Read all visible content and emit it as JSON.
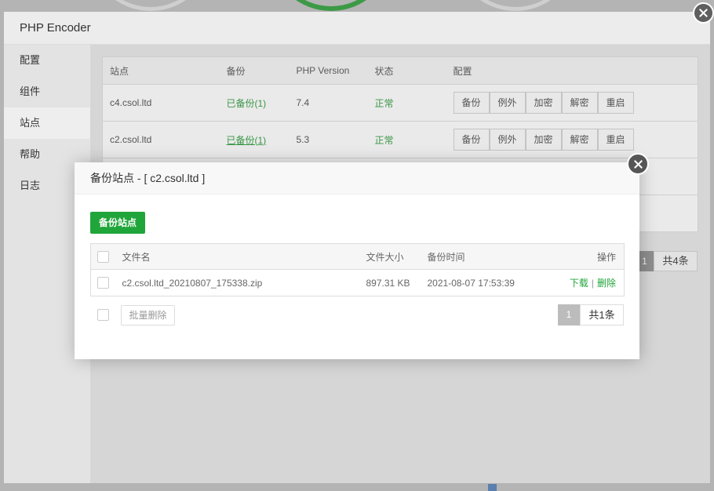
{
  "window": {
    "title": "PHP Encoder",
    "sidebar": {
      "items": [
        {
          "label": "配置",
          "active": false
        },
        {
          "label": "组件",
          "active": false
        },
        {
          "label": "站点",
          "active": true
        },
        {
          "label": "帮助",
          "active": false
        },
        {
          "label": "日志",
          "active": false
        }
      ]
    },
    "sites_table": {
      "headers": {
        "site": "站点",
        "backup": "备份",
        "php_version": "PHP Version",
        "status": "状态",
        "config": "配置"
      },
      "rows": [
        {
          "site": "c4.csol.ltd",
          "backup": "已备份(1)",
          "php_version": "7.4",
          "status": "正常",
          "actions": [
            "备份",
            "例外",
            "加密",
            "解密",
            "重启"
          ]
        },
        {
          "site": "c2.csol.ltd",
          "backup": "已备份(1)",
          "php_version": "5.3",
          "status": "正常",
          "actions": [
            "备份",
            "例外",
            "加密",
            "解密",
            "重启"
          ]
        }
      ]
    },
    "pagination": {
      "current_page": "1",
      "total": "共4条"
    }
  },
  "backup_modal": {
    "title": "备份站点 - [ c2.csol.ltd ]",
    "backup_button": "备份站点",
    "table": {
      "headers": {
        "filename": "文件名",
        "size": "文件大小",
        "time": "备份时间",
        "actions": "操作"
      },
      "rows": [
        {
          "filename": "c2.csol.ltd_20210807_175338.zip",
          "size": "897.31 KB",
          "time": "2021-08-07 17:53:39",
          "download": "下载",
          "separator": "|",
          "delete": "删除"
        }
      ]
    },
    "batch_delete_button": "批量删除",
    "pagination": {
      "current_page": "1",
      "total": "共1条"
    }
  },
  "icons": {
    "window_close": "close-icon",
    "modal_close": "close-icon",
    "checkbox": "checkbox-icon"
  },
  "colors": {
    "accent_green": "#20a53a",
    "modal_header_bg": "#f8f8f8",
    "page_pagination_current": "#bcbcbc"
  }
}
